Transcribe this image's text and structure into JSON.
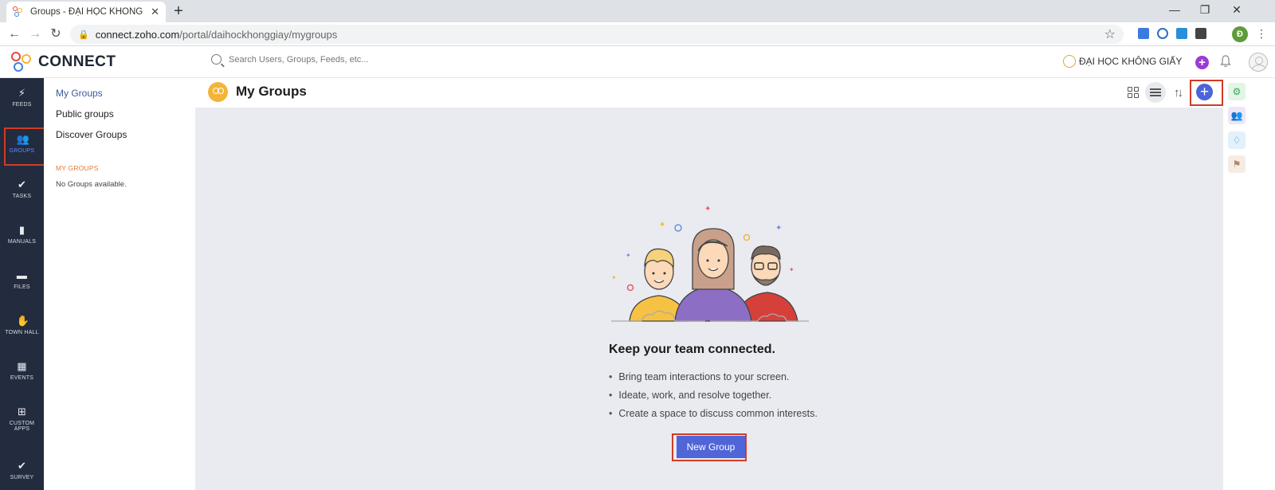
{
  "browser": {
    "tab_title": "Groups - ĐẠI HỌC KHÔNG GIẤY",
    "url_host": "connect.zoho.com",
    "url_path": "/portal/daihockhonggiay/mygroups",
    "profile_initial": "Đ"
  },
  "header": {
    "logo_text": "CONNECT",
    "search_placeholder": "Search Users, Groups, Feeds, etc...",
    "org_name": "ĐẠI HỌC KHÔNG GIẤY"
  },
  "leftnav": {
    "items": [
      {
        "label": "FEEDS",
        "icon": "bolt-icon"
      },
      {
        "label": "GROUPS",
        "icon": "people-icon"
      },
      {
        "label": "TASKS",
        "icon": "check-circle-icon"
      },
      {
        "label": "MANUALS",
        "icon": "manual-icon"
      },
      {
        "label": "FILES",
        "icon": "folder-icon"
      },
      {
        "label": "TOWN HALL",
        "icon": "hand-icon"
      },
      {
        "label": "EVENTS",
        "icon": "calendar-icon"
      },
      {
        "label": "CUSTOM",
        "label2": "APPS",
        "icon": "apps-icon"
      },
      {
        "label": "SURVEY",
        "icon": "survey-icon"
      }
    ]
  },
  "subnav": {
    "my_groups": "My Groups",
    "public_groups": "Public groups",
    "discover_groups": "Discover Groups",
    "section_title": "MY GROUPS",
    "empty_text": "No Groups available."
  },
  "main": {
    "title": "My Groups",
    "headline": "Keep your team connected.",
    "bullets": [
      "Bring team interactions to your screen.",
      "Ideate, work, and resolve together.",
      "Create a space to discuss common interests."
    ],
    "new_group_button": "New Group"
  },
  "colors": {
    "nav_bg": "#232b3e",
    "accent": "#4f65d8",
    "highlight": "#d13b26",
    "content_bg": "#e9ebf0"
  }
}
